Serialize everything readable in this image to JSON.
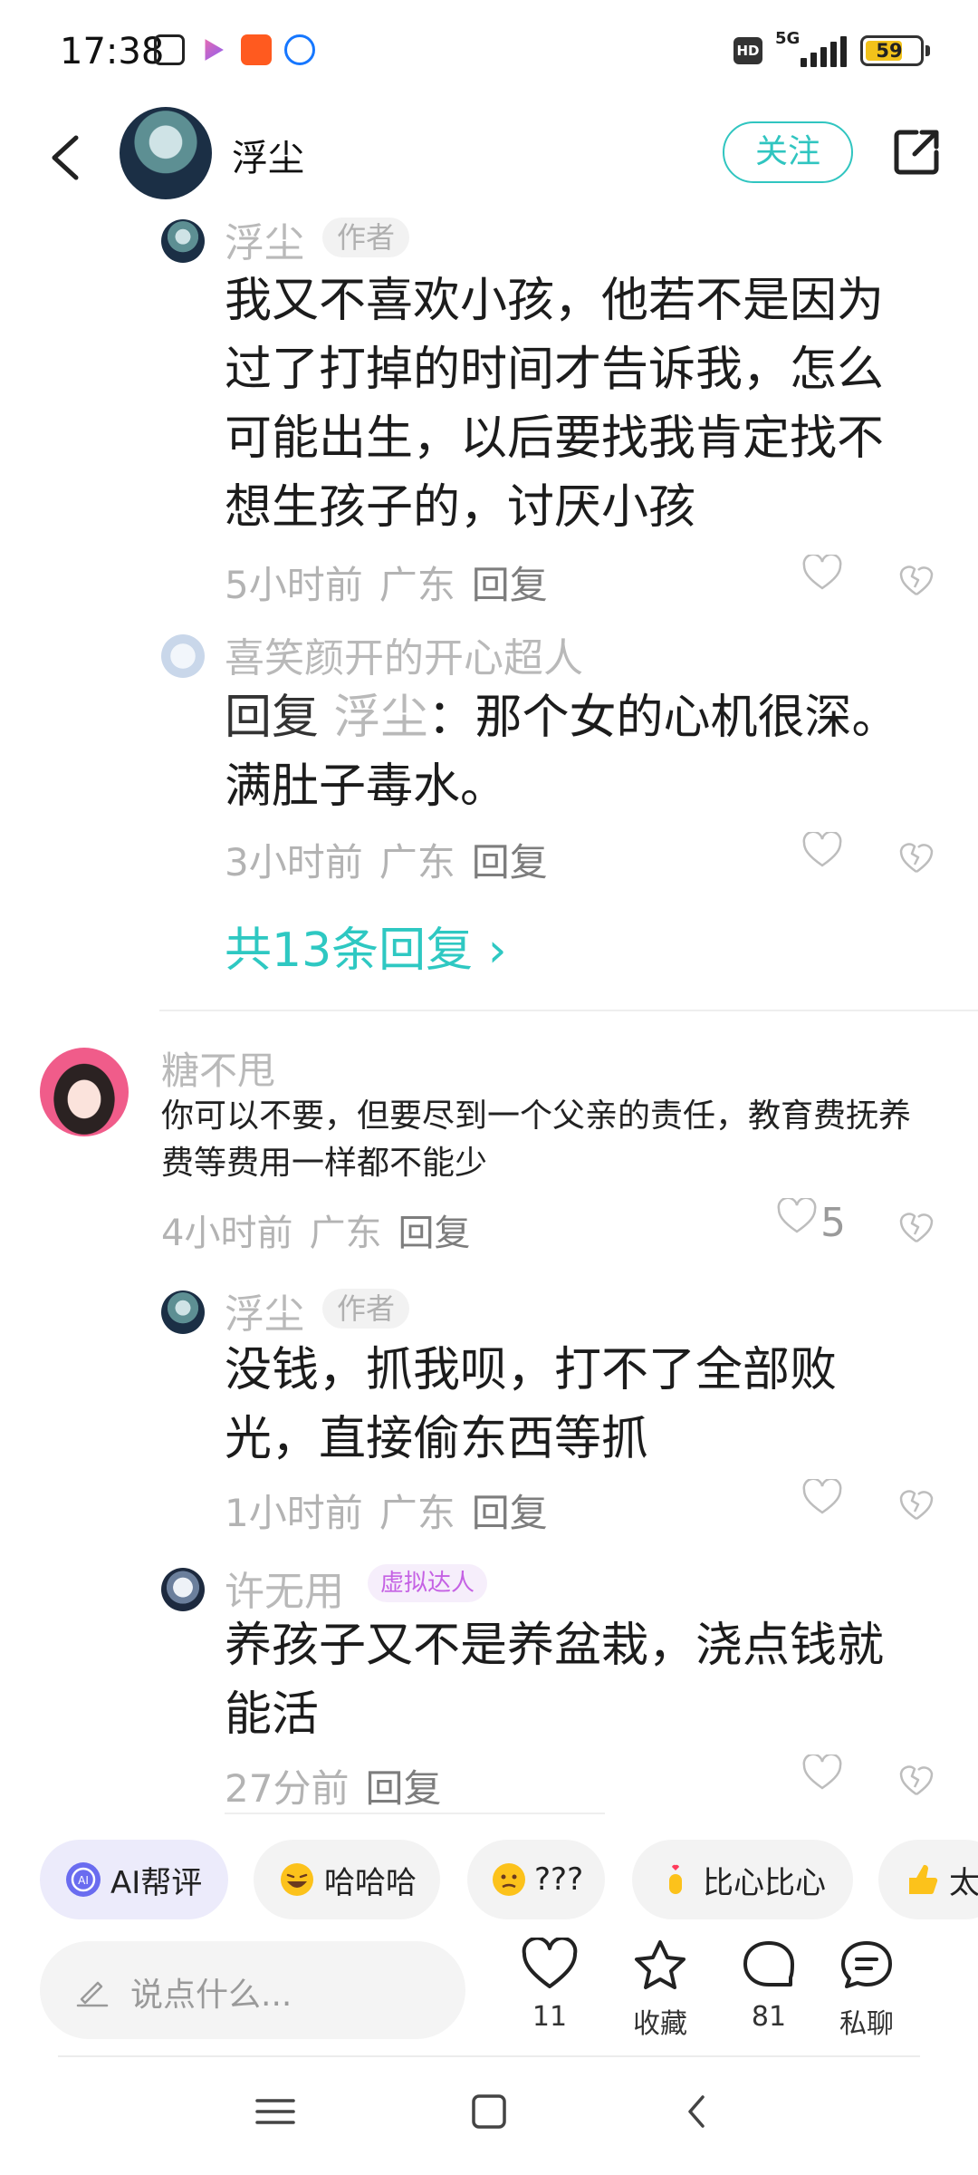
{
  "status_bar": {
    "time": "17:38",
    "network": "5G",
    "hd": "HD",
    "battery": "59"
  },
  "header": {
    "author_name": "浮尘",
    "follow_label": "关注"
  },
  "replies_top": [
    {
      "name": "浮尘",
      "tag": "作者",
      "text": "我又不喜欢小孩，他若不是因为过了打掉的时间才告诉我，怎么可能出生，以后要找我肯定找不想生孩子的，讨厌小孩",
      "time": "5小时前",
      "location": "广东",
      "reply_label": "回复"
    },
    {
      "name": "喜笑颜开的开心超人",
      "reply_prefix": "回复 ",
      "reply_to": "浮尘",
      "text": "：那个女的心机很深。满肚子毒水。",
      "time": "3小时前",
      "location": "广东",
      "reply_label": "回复"
    }
  ],
  "more_replies_label": "共13条回复 ›",
  "comment": {
    "name": "糖不甩",
    "text": "你可以不要，但要尽到一个父亲的责任，教育费抚养费等费用一样都不能少",
    "time": "4小时前",
    "location": "广东",
    "reply_label": "回复",
    "likes": "5"
  },
  "replies_bottom": [
    {
      "name": "浮尘",
      "tag": "作者",
      "text": "没钱，抓我呗，打不了全部败光，直接偷东西等抓",
      "time": "1小时前",
      "location": "广东",
      "reply_label": "回复"
    },
    {
      "name": "许无用",
      "tag": "虚拟达人",
      "text": "养孩子又不是养盆栽，浇点钱就能活",
      "time": "27分前",
      "reply_label": "回复"
    }
  ],
  "chips": [
    {
      "label": "AI帮评",
      "icon": "ai-icon"
    },
    {
      "label": "哈哈哈",
      "icon": "laughing-emoji"
    },
    {
      "label": "???",
      "icon": "confused-emoji"
    },
    {
      "label": "比心比心",
      "icon": "finger-heart-emoji"
    },
    {
      "label": "太",
      "icon": "thumbs-up-emoji"
    }
  ],
  "bottom_bar": {
    "input_placeholder": "说点什么...",
    "like_count": "11",
    "collect_label": "收藏",
    "comment_count": "81",
    "chat_label": "私聊"
  },
  "colors": {
    "accent": "#30c5c0",
    "virtual_tag": "#c562e4"
  }
}
